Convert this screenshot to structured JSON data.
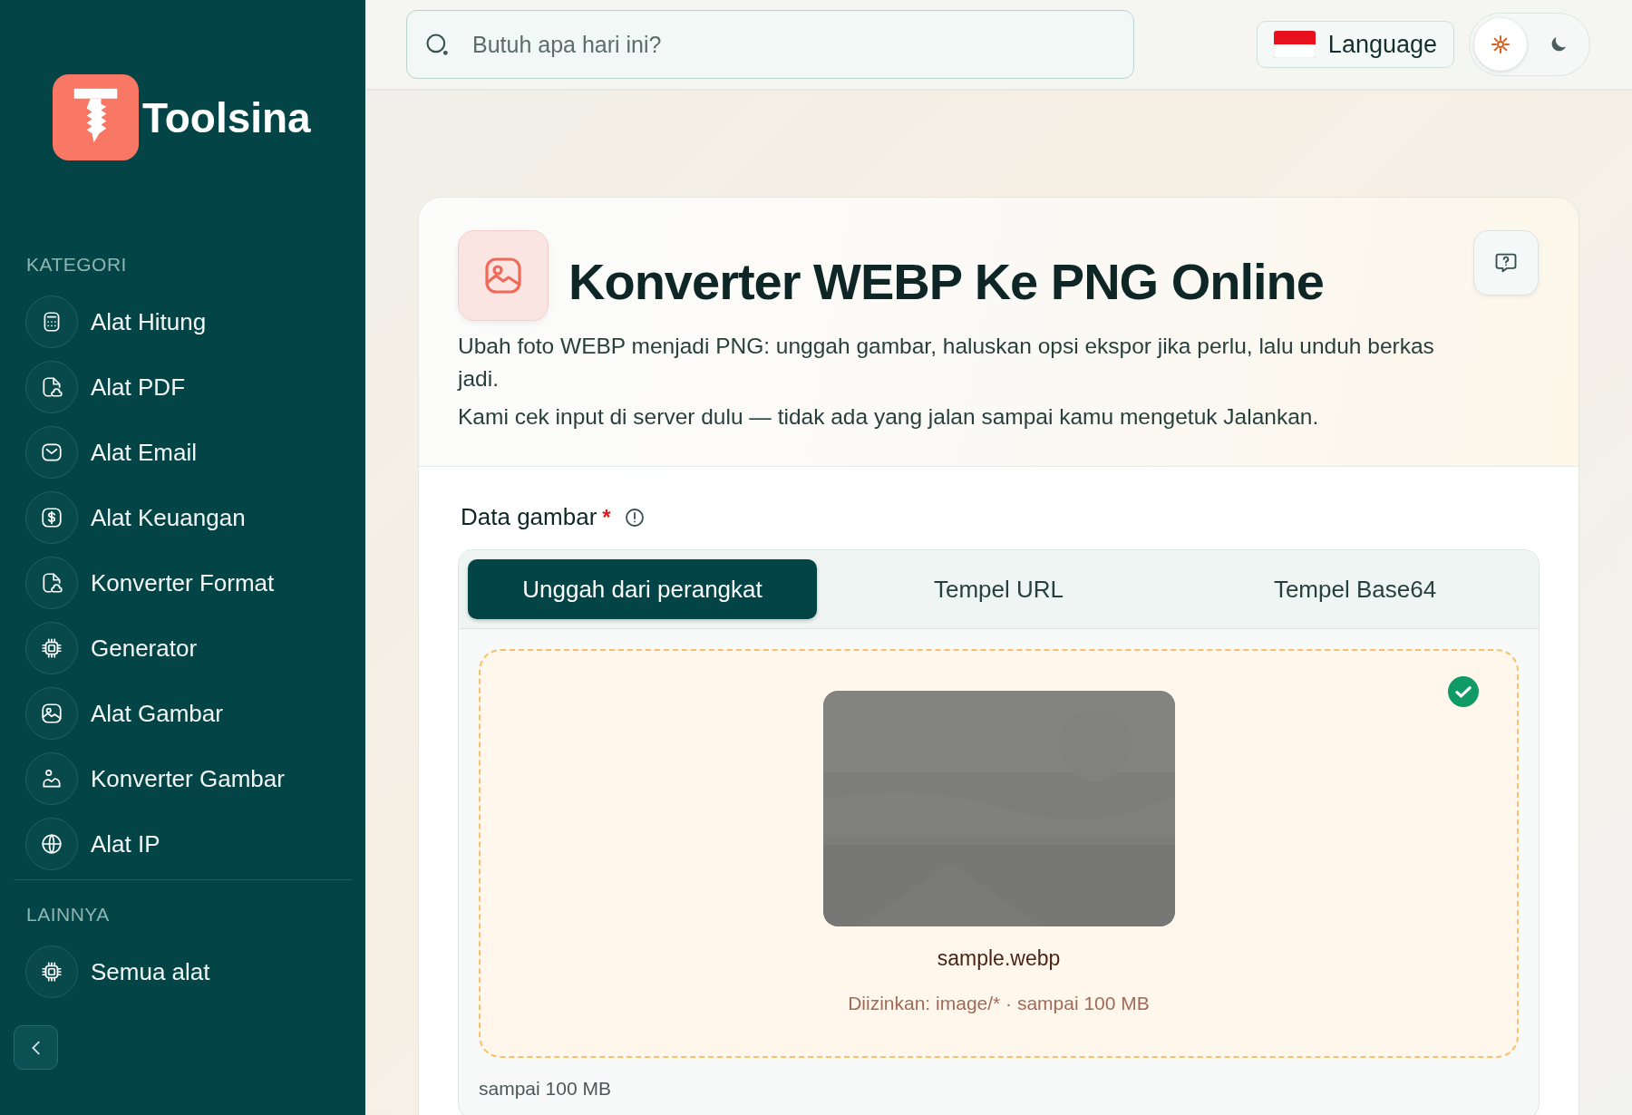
{
  "sidebar": {
    "brand": "Toolsina",
    "sections": [
      {
        "title": "KATEGORI",
        "items": [
          {
            "label": "Alat Hitung"
          },
          {
            "label": "Alat PDF"
          },
          {
            "label": "Alat Email"
          },
          {
            "label": "Alat Keuangan"
          },
          {
            "label": "Konverter Format"
          },
          {
            "label": "Generator"
          },
          {
            "label": "Alat Gambar"
          },
          {
            "label": "Konverter Gambar"
          },
          {
            "label": "Alat IP"
          }
        ]
      },
      {
        "title": "LAINNYA",
        "items": [
          {
            "label": "Semua alat"
          }
        ]
      }
    ]
  },
  "header": {
    "search": {
      "placeholder": "Butuh apa hari ini?"
    },
    "language": "Language",
    "theme_options": [
      {
        "selected": true
      },
      {
        "selected": false
      }
    ]
  },
  "tool": {
    "title": "Konverter WEBP Ke PNG Online",
    "descriptions": [
      "Ubah foto WEBP menjadi PNG: unggah gambar, haluskan opsi ekspor jika perlu, lalu unduh berkas jadi.",
      "Kami cek input di server dulu — tidak ada yang jalan sampai kamu mengetuk Jalankan."
    ],
    "field_label": "Data gambar",
    "required_mark": "*",
    "tabs": [
      {
        "label": "Unggah dari perangkat",
        "selected": true
      },
      {
        "label": "Tempel URL",
        "selected": false
      },
      {
        "label": "Tempel Base64",
        "selected": false
      }
    ],
    "upload": {
      "uploaded": true,
      "file_name": "sample.webp",
      "allowed": "Diizinkan: image/* · sampai 100 MB"
    },
    "hint": "sampai 100 MB"
  }
}
